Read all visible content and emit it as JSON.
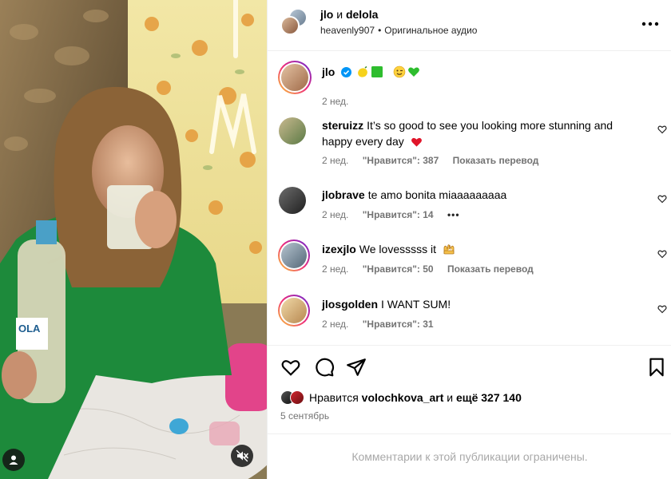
{
  "header": {
    "user1": "jlo",
    "conjunction": "и",
    "user2": "delola",
    "audio_user": "heavenly907",
    "separator": "•",
    "audio_label": "Оригинальное аудио",
    "more_icon": "more-horizontal-icon"
  },
  "caption": {
    "username": "jlo",
    "time": "2 нед.",
    "emojis": [
      "lemon",
      "green-square",
      "winking-face",
      "green-heart"
    ]
  },
  "comments": [
    {
      "username": "steruizz",
      "text": "It’s so good to see you looking more stunning and happy every day",
      "emoji": "red-heart",
      "time": "2 нед.",
      "likes": "\"Нравится\": 387",
      "translate": "Показать перевод",
      "more": ""
    },
    {
      "username": "jlobrave",
      "text": "te amo bonita miaaaaaaaaa",
      "time": "2 нед.",
      "likes": "\"Нравится\": 14",
      "translate": "",
      "more": "•••"
    },
    {
      "username": "izexjlo",
      "text": "We lovesssss it",
      "emoji": "raising-hands",
      "time": "2 нед.",
      "likes": "\"Нравится\": 50",
      "translate": "Показать перевод",
      "more": ""
    },
    {
      "username": "jlosgolden",
      "text": "I WANT SUM!",
      "time": "2 нед.",
      "likes": "\"Нравится\": 31",
      "translate": "",
      "more": ""
    }
  ],
  "actions": {
    "like_icon": "heart-icon",
    "comment_icon": "comment-icon",
    "share_icon": "send-icon",
    "save_icon": "bookmark-icon"
  },
  "likes": {
    "prefix": "Нравится",
    "user": "volochkova_art",
    "middle": "и",
    "others": "ещё 327 140"
  },
  "date": "5 сентябрь",
  "footer": "Комментарии к этой публикации ограничены.",
  "media": {
    "tag_icon": "user-tag-icon",
    "mute_icon": "muted-speaker-icon"
  },
  "colors": {
    "secondary_text": "#737373",
    "divider": "#efefef",
    "verified": "#0095f6",
    "heart_red": "#ed4956"
  }
}
